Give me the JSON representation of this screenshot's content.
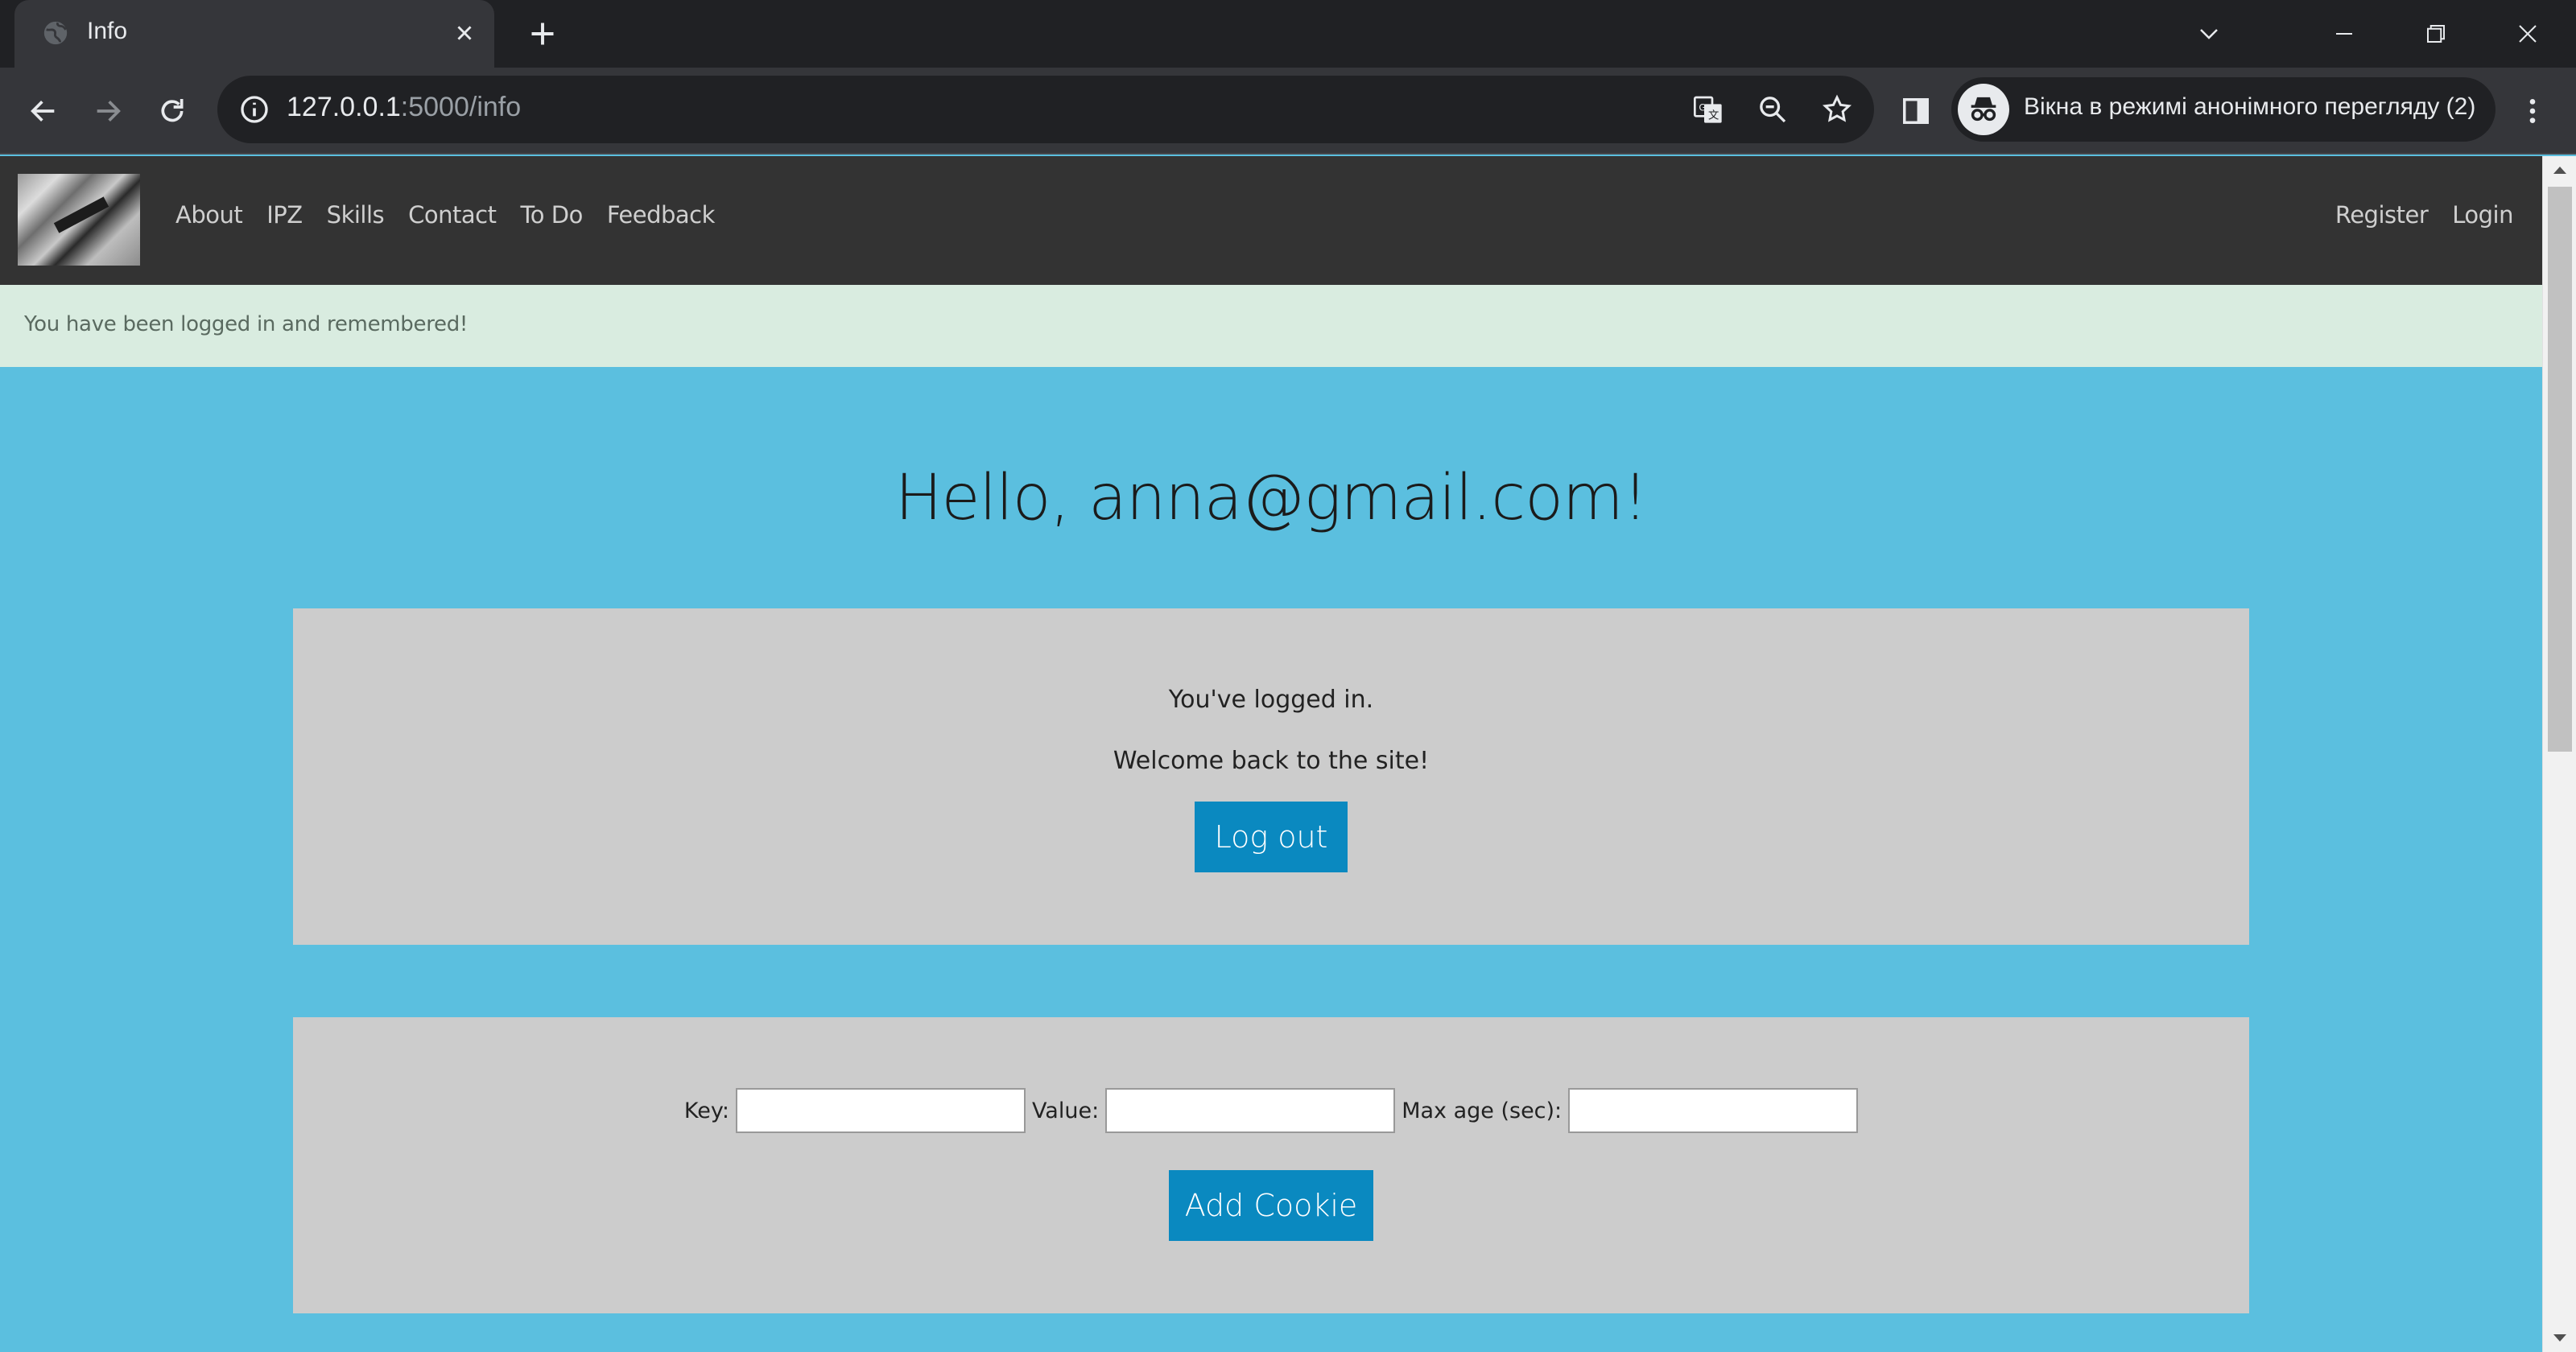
{
  "browser": {
    "tab_title": "Info",
    "url_host": "127.0.0.1",
    "url_rest": ":5000/info",
    "incognito_label": "Вікна в режимі анонімного перегляду (2)"
  },
  "navbar": {
    "links": [
      "About",
      "IPZ",
      "Skills",
      "Contact",
      "To Do",
      "Feedback"
    ],
    "right_links": [
      "Register",
      "Login"
    ]
  },
  "flash": {
    "message": "You have been logged in and remembered!"
  },
  "main": {
    "greeting": "Hello, anna@gmail.com!",
    "status_line1": "You've logged in.",
    "status_line2": "Welcome back to the site!",
    "logout_label": "Log out"
  },
  "cookie_form": {
    "key_label": "Key:",
    "value_label": "Value:",
    "max_age_label": "Max age (sec):",
    "submit_label": "Add Cookie"
  },
  "colors": {
    "page_background": "#5bbfdf",
    "navbar": "#333333",
    "flash_background": "#d9ece0",
    "panel": "#cccccc",
    "button": "#0a89c0"
  }
}
